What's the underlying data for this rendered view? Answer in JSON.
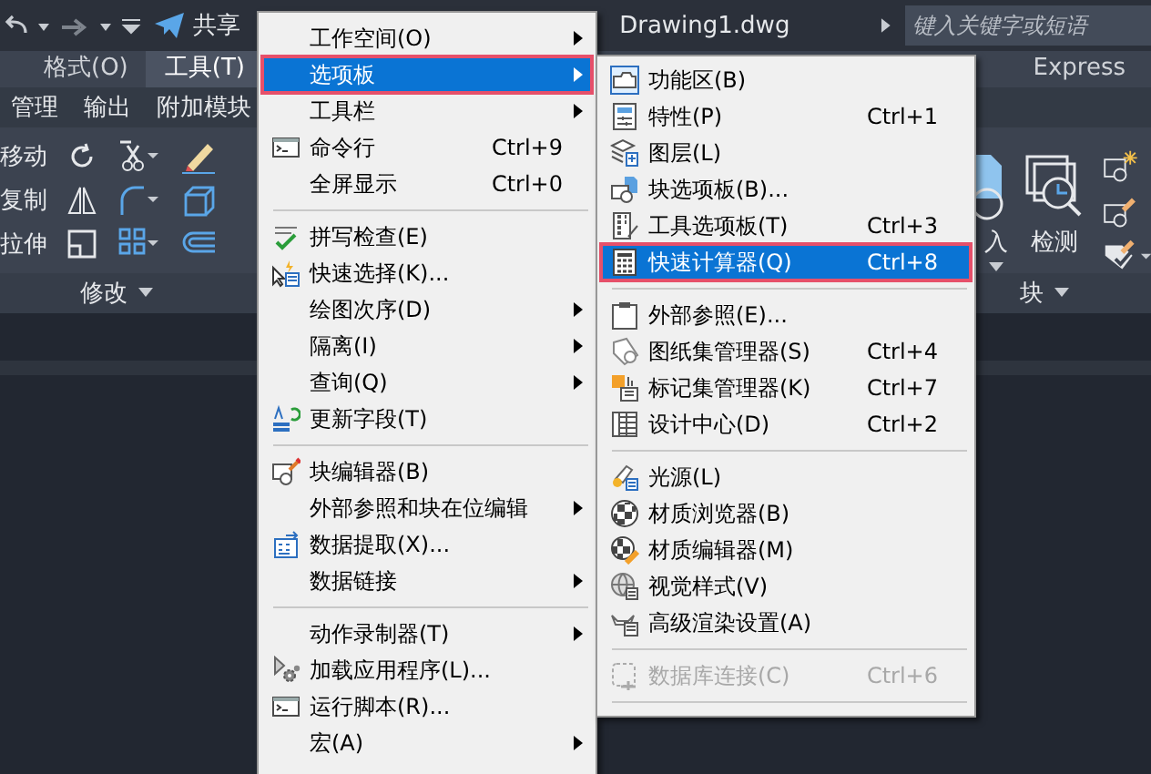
{
  "quick_access": {
    "share": "共享"
  },
  "document_title": "Drawing1.dwg",
  "search": {
    "placeholder": "键入关键字或短语"
  },
  "ribbon_tabs": [
    {
      "label": "格式(O)",
      "selected": false
    },
    {
      "label": "工具(T)",
      "selected": true
    },
    {
      "label": "Express",
      "selected": false
    }
  ],
  "panel_tabs": [
    "管理",
    "输出",
    "附加模块"
  ],
  "modify_panel": {
    "tools": [
      "移动",
      "复制",
      "拉伸"
    ],
    "title": "修改"
  },
  "block_panel": {
    "tools": [
      "入",
      "检测"
    ],
    "title": "块"
  },
  "tools_menu": {
    "items": [
      {
        "kind": "item",
        "label": "工作空间(O)",
        "has_submenu": true,
        "selected": false
      },
      {
        "kind": "item",
        "label": "选项板",
        "has_submenu": true,
        "selected": true
      },
      {
        "kind": "item",
        "label": "工具栏",
        "has_submenu": true,
        "selected": false
      },
      {
        "kind": "item",
        "label": "命令行",
        "shortcut": "Ctrl+9",
        "has_submenu": false,
        "selected": false
      },
      {
        "kind": "item",
        "label": "全屏显示",
        "shortcut": "Ctrl+0",
        "has_submenu": false,
        "selected": false
      },
      {
        "kind": "separator"
      },
      {
        "kind": "item",
        "label": "拼写检查(E)",
        "has_submenu": false,
        "selected": false
      },
      {
        "kind": "item",
        "label": "快速选择(K)...",
        "has_submenu": false,
        "selected": false
      },
      {
        "kind": "item",
        "label": "绘图次序(D)",
        "has_submenu": true,
        "selected": false
      },
      {
        "kind": "item",
        "label": "隔离(I)",
        "has_submenu": true,
        "selected": false
      },
      {
        "kind": "item",
        "label": "查询(Q)",
        "has_submenu": true,
        "selected": false
      },
      {
        "kind": "item",
        "label": "更新字段(T)",
        "has_submenu": false,
        "selected": false
      },
      {
        "kind": "separator"
      },
      {
        "kind": "item",
        "label": "块编辑器(B)",
        "has_submenu": false,
        "selected": false
      },
      {
        "kind": "item",
        "label": "外部参照和块在位编辑",
        "has_submenu": true,
        "selected": false
      },
      {
        "kind": "item",
        "label": "数据提取(X)...",
        "has_submenu": false,
        "selected": false
      },
      {
        "kind": "item",
        "label": "数据链接",
        "has_submenu": true,
        "selected": false
      },
      {
        "kind": "separator"
      },
      {
        "kind": "item",
        "label": "动作录制器(T)",
        "has_submenu": true,
        "selected": false
      },
      {
        "kind": "item",
        "label": "加载应用程序(L)...",
        "has_submenu": false,
        "selected": false
      },
      {
        "kind": "item",
        "label": "运行脚本(R)...",
        "has_submenu": false,
        "selected": false
      },
      {
        "kind": "item",
        "label": "宏(A)",
        "has_submenu": true,
        "selected": false
      }
    ]
  },
  "palettes_submenu": {
    "items": [
      {
        "kind": "item",
        "label": "功能区(B)",
        "selected": false,
        "disabled": false
      },
      {
        "kind": "item",
        "label": "特性(P)",
        "shortcut": "Ctrl+1",
        "selected": false,
        "disabled": false
      },
      {
        "kind": "item",
        "label": "图层(L)",
        "selected": false,
        "disabled": false
      },
      {
        "kind": "item",
        "label": " 块选项板(B)...",
        "selected": false,
        "disabled": false
      },
      {
        "kind": "item",
        "label": "工具选项板(T)",
        "shortcut": "Ctrl+3",
        "selected": false,
        "disabled": false
      },
      {
        "kind": "item",
        "label": "快速计算器(Q)",
        "shortcut": "Ctrl+8",
        "selected": true,
        "disabled": false
      },
      {
        "kind": "separator"
      },
      {
        "kind": "item",
        "label": "外部参照(E)...",
        "selected": false,
        "disabled": false
      },
      {
        "kind": "item",
        "label": "图纸集管理器(S)",
        "shortcut": "Ctrl+4",
        "selected": false,
        "disabled": false
      },
      {
        "kind": "item",
        "label": "标记集管理器(K)",
        "shortcut": "Ctrl+7",
        "selected": false,
        "disabled": false
      },
      {
        "kind": "item",
        "label": "设计中心(D)",
        "shortcut": "Ctrl+2",
        "selected": false,
        "disabled": false
      },
      {
        "kind": "separator"
      },
      {
        "kind": "item",
        "label": "光源(L)",
        "selected": false,
        "disabled": false
      },
      {
        "kind": "item",
        "label": "材质浏览器(B)",
        "selected": false,
        "disabled": false
      },
      {
        "kind": "item",
        "label": "材质编辑器(M)",
        "selected": false,
        "disabled": false
      },
      {
        "kind": "item",
        "label": "视觉样式(V)",
        "selected": false,
        "disabled": false
      },
      {
        "kind": "item",
        "label": "高级渲染设置(A)",
        "selected": false,
        "disabled": false
      },
      {
        "kind": "separator"
      },
      {
        "kind": "item",
        "label": "数据库连接(C)",
        "shortcut": "Ctrl+6",
        "selected": false,
        "disabled": true
      },
      {
        "kind": "separator"
      }
    ]
  }
}
